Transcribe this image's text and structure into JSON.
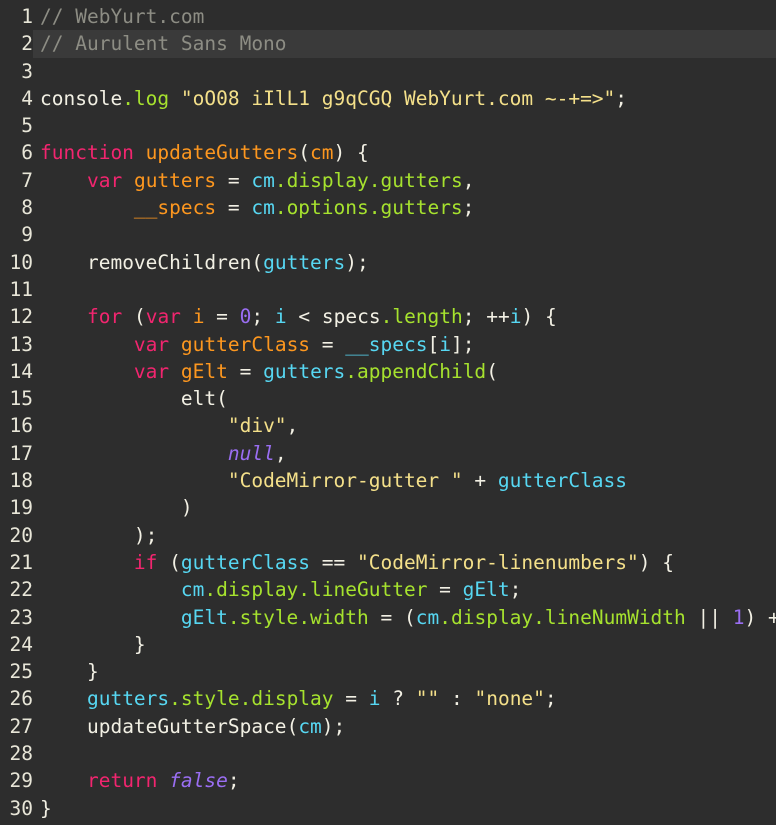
{
  "editor": {
    "name": "code-editor",
    "language": "javascript",
    "theme": "monokai-dark",
    "colors": {
      "background": "#2d2d2d",
      "active_line_background": "#3a3a3a",
      "line_number": "#e8e6d8",
      "comment": "#8d8d84",
      "keyword": "#f2256f",
      "definition": "#fd971f",
      "variable": "#57d7f2",
      "property": "#a6e22e",
      "string": "#f4e08a",
      "number": "#9a6ef2",
      "atom": "#9a6ef2",
      "plain": "#f2f0e4"
    },
    "active_line": 2,
    "total_lines": 30,
    "lines": [
      {
        "n": "1",
        "text": "// WebYurt.com"
      },
      {
        "n": "2",
        "text": "// Aurulent Sans Mono"
      },
      {
        "n": "3",
        "text": ""
      },
      {
        "n": "4",
        "text": "console.log \"oO08 iIlL1 g9qCGQ WebYurt.com ~-+=>\";"
      },
      {
        "n": "5",
        "text": ""
      },
      {
        "n": "6",
        "text": "function updateGutters(cm) {"
      },
      {
        "n": "7",
        "text": "    var gutters = cm.display.gutters,"
      },
      {
        "n": "8",
        "text": "        __specs = cm.options.gutters;"
      },
      {
        "n": "9",
        "text": ""
      },
      {
        "n": "10",
        "text": "    removeChildren(gutters);"
      },
      {
        "n": "11",
        "text": ""
      },
      {
        "n": "12",
        "text": "    for (var i = 0; i < specs.length; ++i) {"
      },
      {
        "n": "13",
        "text": "        var gutterClass = __specs[i];"
      },
      {
        "n": "14",
        "text": "        var gElt = gutters.appendChild("
      },
      {
        "n": "15",
        "text": "            elt("
      },
      {
        "n": "16",
        "text": "                \"div\","
      },
      {
        "n": "17",
        "text": "                null,"
      },
      {
        "n": "18",
        "text": "                \"CodeMirror-gutter \" + gutterClass"
      },
      {
        "n": "19",
        "text": "            )"
      },
      {
        "n": "20",
        "text": "        );"
      },
      {
        "n": "21",
        "text": "        if (gutterClass == \"CodeMirror-linenumbers\") {"
      },
      {
        "n": "22",
        "text": "            cm.display.lineGutter = gElt;"
      },
      {
        "n": "23",
        "text": "            gElt.style.width = (cm.display.lineNumWidth || 1) +"
      },
      {
        "n": "24",
        "text": "        }"
      },
      {
        "n": "25",
        "text": "    }"
      },
      {
        "n": "26",
        "text": "    gutters.style.display = i ? \"\" : \"none\";"
      },
      {
        "n": "27",
        "text": "    updateGutterSpace(cm);"
      },
      {
        "n": "28",
        "text": ""
      },
      {
        "n": "29",
        "text": "    return false;"
      },
      {
        "n": "30",
        "text": "}"
      }
    ],
    "tokens": [
      [
        {
          "c": "t-comment",
          "s": "// WebYurt.com"
        }
      ],
      [
        {
          "c": "t-comment",
          "s": "// Aurulent Sans Mono"
        }
      ],
      [],
      [
        {
          "c": "t-plain",
          "s": "console"
        },
        {
          "c": "t-prop",
          "s": ".log"
        },
        {
          "c": "t-plain",
          "s": " "
        },
        {
          "c": "t-string",
          "s": "\"oO08 iIlL1 g9qCGQ WebYurt.com ~-+=>\""
        },
        {
          "c": "t-plain",
          "s": ";"
        }
      ],
      [],
      [
        {
          "c": "t-keyword",
          "s": "function"
        },
        {
          "c": "t-plain",
          "s": " "
        },
        {
          "c": "t-fnname",
          "s": "updateGutters"
        },
        {
          "c": "t-bracket",
          "s": "("
        },
        {
          "c": "t-def",
          "s": "cm"
        },
        {
          "c": "t-bracket",
          "s": ") {"
        }
      ],
      [
        {
          "c": "t-plain",
          "s": "    "
        },
        {
          "c": "t-keyword",
          "s": "var"
        },
        {
          "c": "t-plain",
          "s": " "
        },
        {
          "c": "t-def",
          "s": "gutters"
        },
        {
          "c": "t-op",
          "s": " = "
        },
        {
          "c": "t-var",
          "s": "cm"
        },
        {
          "c": "t-prop",
          "s": ".display"
        },
        {
          "c": "t-prop",
          "s": ".gutters"
        },
        {
          "c": "t-plain",
          "s": ","
        }
      ],
      [
        {
          "c": "t-plain",
          "s": "        "
        },
        {
          "c": "t-def",
          "s": "__specs"
        },
        {
          "c": "t-op",
          "s": " = "
        },
        {
          "c": "t-var",
          "s": "cm"
        },
        {
          "c": "t-prop",
          "s": ".options"
        },
        {
          "c": "t-prop",
          "s": ".gutters"
        },
        {
          "c": "t-plain",
          "s": ";"
        }
      ],
      [],
      [
        {
          "c": "t-plain",
          "s": "    "
        },
        {
          "c": "t-plain",
          "s": "removeChildren"
        },
        {
          "c": "t-bracket",
          "s": "("
        },
        {
          "c": "t-var",
          "s": "gutters"
        },
        {
          "c": "t-bracket",
          "s": ");"
        }
      ],
      [],
      [
        {
          "c": "t-plain",
          "s": "    "
        },
        {
          "c": "t-keyword",
          "s": "for"
        },
        {
          "c": "t-plain",
          "s": " "
        },
        {
          "c": "t-bracket",
          "s": "("
        },
        {
          "c": "t-keyword",
          "s": "var"
        },
        {
          "c": "t-plain",
          "s": " "
        },
        {
          "c": "t-def",
          "s": "i"
        },
        {
          "c": "t-op",
          "s": " = "
        },
        {
          "c": "t-number",
          "s": "0"
        },
        {
          "c": "t-plain",
          "s": "; "
        },
        {
          "c": "t-var",
          "s": "i"
        },
        {
          "c": "t-op",
          "s": " < "
        },
        {
          "c": "t-plain",
          "s": "specs"
        },
        {
          "c": "t-prop",
          "s": ".length"
        },
        {
          "c": "t-plain",
          "s": "; "
        },
        {
          "c": "t-op",
          "s": "++"
        },
        {
          "c": "t-var",
          "s": "i"
        },
        {
          "c": "t-bracket",
          "s": ") {"
        }
      ],
      [
        {
          "c": "t-plain",
          "s": "        "
        },
        {
          "c": "t-keyword",
          "s": "var"
        },
        {
          "c": "t-plain",
          "s": " "
        },
        {
          "c": "t-def",
          "s": "gutterClass"
        },
        {
          "c": "t-op",
          "s": " = "
        },
        {
          "c": "t-var",
          "s": "__specs"
        },
        {
          "c": "t-bracket",
          "s": "["
        },
        {
          "c": "t-var",
          "s": "i"
        },
        {
          "c": "t-bracket",
          "s": "]"
        },
        {
          "c": "t-plain",
          "s": ";"
        }
      ],
      [
        {
          "c": "t-plain",
          "s": "        "
        },
        {
          "c": "t-keyword",
          "s": "var"
        },
        {
          "c": "t-plain",
          "s": " "
        },
        {
          "c": "t-def",
          "s": "gElt"
        },
        {
          "c": "t-op",
          "s": " = "
        },
        {
          "c": "t-var",
          "s": "gutters"
        },
        {
          "c": "t-prop",
          "s": ".appendChild"
        },
        {
          "c": "t-bracket",
          "s": "("
        }
      ],
      [
        {
          "c": "t-plain",
          "s": "            "
        },
        {
          "c": "t-plain",
          "s": "elt"
        },
        {
          "c": "t-bracket",
          "s": "("
        }
      ],
      [
        {
          "c": "t-plain",
          "s": "                "
        },
        {
          "c": "t-string",
          "s": "\"div\""
        },
        {
          "c": "t-plain",
          "s": ","
        }
      ],
      [
        {
          "c": "t-plain",
          "s": "                "
        },
        {
          "c": "t-atom",
          "s": "null"
        },
        {
          "c": "t-plain",
          "s": ","
        }
      ],
      [
        {
          "c": "t-plain",
          "s": "                "
        },
        {
          "c": "t-string",
          "s": "\"CodeMirror-gutter \""
        },
        {
          "c": "t-op",
          "s": " + "
        },
        {
          "c": "t-var",
          "s": "gutterClass"
        }
      ],
      [
        {
          "c": "t-plain",
          "s": "            "
        },
        {
          "c": "t-bracket",
          "s": ")"
        }
      ],
      [
        {
          "c": "t-plain",
          "s": "        "
        },
        {
          "c": "t-bracket",
          "s": ");"
        }
      ],
      [
        {
          "c": "t-plain",
          "s": "        "
        },
        {
          "c": "t-keyword",
          "s": "if"
        },
        {
          "c": "t-plain",
          "s": " "
        },
        {
          "c": "t-bracket",
          "s": "("
        },
        {
          "c": "t-var",
          "s": "gutterClass"
        },
        {
          "c": "t-op",
          "s": " == "
        },
        {
          "c": "t-string",
          "s": "\"CodeMirror-linenumbers\""
        },
        {
          "c": "t-bracket",
          "s": ") {"
        }
      ],
      [
        {
          "c": "t-plain",
          "s": "            "
        },
        {
          "c": "t-var",
          "s": "cm"
        },
        {
          "c": "t-prop",
          "s": ".display"
        },
        {
          "c": "t-prop",
          "s": ".lineGutter"
        },
        {
          "c": "t-op",
          "s": " = "
        },
        {
          "c": "t-var",
          "s": "gElt"
        },
        {
          "c": "t-plain",
          "s": ";"
        }
      ],
      [
        {
          "c": "t-plain",
          "s": "            "
        },
        {
          "c": "t-var",
          "s": "gElt"
        },
        {
          "c": "t-prop",
          "s": ".style"
        },
        {
          "c": "t-prop",
          "s": ".width"
        },
        {
          "c": "t-op",
          "s": " = "
        },
        {
          "c": "t-bracket",
          "s": "("
        },
        {
          "c": "t-var",
          "s": "cm"
        },
        {
          "c": "t-prop",
          "s": ".display"
        },
        {
          "c": "t-prop",
          "s": ".lineNumWidth"
        },
        {
          "c": "t-op",
          "s": " || "
        },
        {
          "c": "t-number",
          "s": "1"
        },
        {
          "c": "t-bracket",
          "s": ")"
        },
        {
          "c": "t-op",
          "s": " +"
        }
      ],
      [
        {
          "c": "t-plain",
          "s": "        "
        },
        {
          "c": "t-bracket",
          "s": "}"
        }
      ],
      [
        {
          "c": "t-plain",
          "s": "    "
        },
        {
          "c": "t-bracket",
          "s": "}"
        }
      ],
      [
        {
          "c": "t-plain",
          "s": "    "
        },
        {
          "c": "t-var",
          "s": "gutters"
        },
        {
          "c": "t-prop",
          "s": ".style"
        },
        {
          "c": "t-prop",
          "s": ".display"
        },
        {
          "c": "t-op",
          "s": " = "
        },
        {
          "c": "t-var",
          "s": "i"
        },
        {
          "c": "t-op",
          "s": " ? "
        },
        {
          "c": "t-string",
          "s": "\"\""
        },
        {
          "c": "t-op",
          "s": " : "
        },
        {
          "c": "t-string",
          "s": "\"none\""
        },
        {
          "c": "t-plain",
          "s": ";"
        }
      ],
      [
        {
          "c": "t-plain",
          "s": "    "
        },
        {
          "c": "t-plain",
          "s": "updateGutterSpace"
        },
        {
          "c": "t-bracket",
          "s": "("
        },
        {
          "c": "t-var",
          "s": "cm"
        },
        {
          "c": "t-bracket",
          "s": ");"
        }
      ],
      [],
      [
        {
          "c": "t-plain",
          "s": "    "
        },
        {
          "c": "t-keyword",
          "s": "return"
        },
        {
          "c": "t-plain",
          "s": " "
        },
        {
          "c": "t-atom",
          "s": "false"
        },
        {
          "c": "t-plain",
          "s": ";"
        }
      ],
      [
        {
          "c": "t-bracket",
          "s": "}"
        }
      ]
    ]
  }
}
